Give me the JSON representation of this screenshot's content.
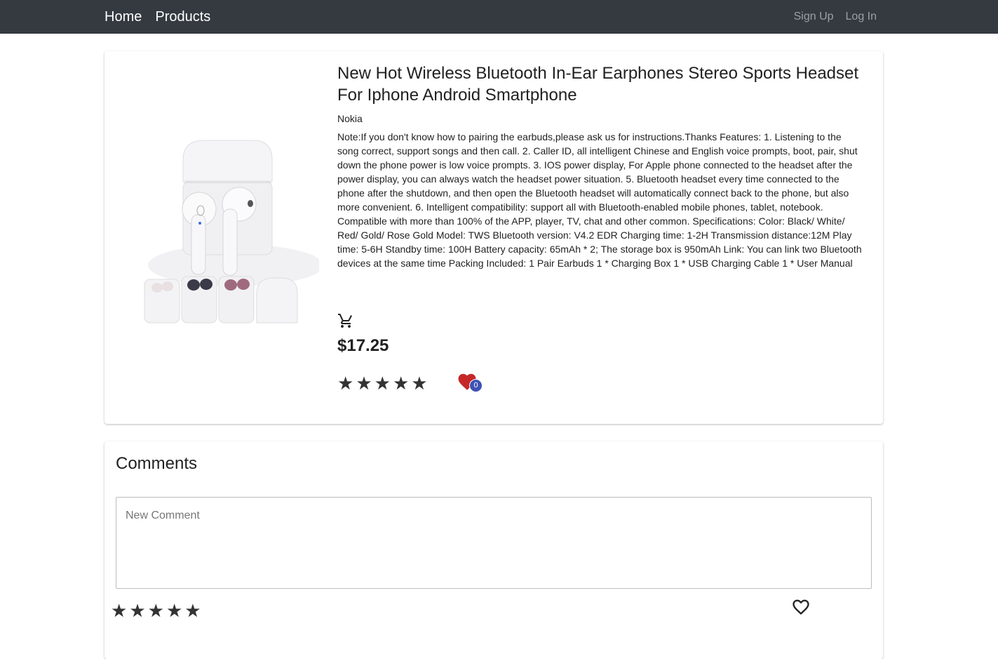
{
  "nav": {
    "home": "Home",
    "products": "Products",
    "signup": "Sign Up",
    "login": "Log In"
  },
  "product": {
    "title": "New Hot Wireless Bluetooth In-Ear Earphones Stereo Sports Headset For Iphone Android Smartphone",
    "brand": "Nokia",
    "description": "Note:If you don't know how to pairing the earbuds,please ask us for instructions.Thanks Features: 1. Listening to the song correct, support songs and then call. 2. Caller ID, all intelligent Chinese and English voice prompts, boot, pair, shut down the phone power is low voice prompts. 3. IOS power display, For Apple phone connected to the headset after the power display, you can always watch the headset power situation. 5. Bluetooth headset every time connected to the phone after the shutdown, and then open the Bluetooth headset will automatically connect back to the phone, but also more convenient. 6. Intelligent compatibility: support all with Bluetooth-enabled mobile phones, tablet, notebook. Compatible with more than 100% of the APP, player, TV, chat and other common. Specifications: Color: Black/ White/ Red/ Gold/ Rose Gold Model: TWS Bluetooth version: V4.2 EDR Charging time: 1-2H Transmission distance:12M Play time: 5-6H Standby time: 100H Battery capacity: 65mAh * 2; The storage box is 950mAh Link: You can link two Bluetooth devices at the same time Packing Included: 1 Pair Earbuds 1 * Charging Box 1 * USB Charging Cable 1 * User Manual",
    "price": "$17.25",
    "rating_stars": 5,
    "likes": "0",
    "icons": {
      "cart": "shopping-cart-icon",
      "like": "heart-icon"
    },
    "colors": {
      "heart": "#c62828",
      "badge": "#3f51b5"
    }
  },
  "comments": {
    "title": "Comments",
    "placeholder": "New Comment",
    "rating_stars": 5,
    "icons": {
      "like": "heart-outline-icon"
    }
  },
  "colors": {
    "navbar": "#343a40",
    "nav_active": "#ffffff",
    "nav_muted": "#9aa0a6"
  }
}
